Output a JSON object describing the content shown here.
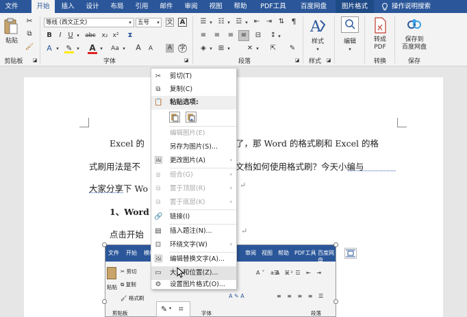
{
  "tabs": [
    "文件",
    "开始",
    "插入",
    "设计",
    "布局",
    "引用",
    "邮件",
    "审阅",
    "视图",
    "帮助",
    "PDF工具",
    "百度网盘",
    "图片格式",
    "操作说明搜索"
  ],
  "ribbon": {
    "paste_label": "粘贴",
    "clipboard_group": "剪贴板",
    "font_name": "等线 (西文正文)",
    "font_size": "五号",
    "font_group": "字体",
    "paragraph_group": "段落",
    "styles_label": "样式",
    "styles_group": "样式",
    "edit_label": "编辑",
    "convert_label": "转成\nPDF",
    "convert_group": "转换",
    "save_label": "保存到\n百度网盘",
    "save_group": "保存",
    "font_grow": "A",
    "font_shrink": "A",
    "wen": "文",
    "change_case": "Aa"
  },
  "document": {
    "lines": [
      "Excel 的",
      "了，那 Word 的格式刷和 Excel 的格",
      "式刷用法是不",
      "文档如何使用格式刷？今天小编与",
      "大家分享下 Wo",
      "1、Word",
      "点击开始"
    ]
  },
  "context_menu": {
    "items": [
      {
        "label": "剪切(T)",
        "icon": "cut-icon",
        "disabled": false
      },
      {
        "label": "复制(C)",
        "icon": "copy-icon",
        "disabled": false
      },
      {
        "label": "粘贴选项:",
        "icon": "paste-icon",
        "header": true
      },
      {
        "label": "编辑图片(E)",
        "disabled": true
      },
      {
        "label": "另存为图片(S)...",
        "disabled": false
      },
      {
        "label": "更改图片(A)",
        "icon": "change-picture-icon",
        "disabled": false,
        "submenu": true
      },
      {
        "label": "组合(G)",
        "icon": "group-icon",
        "disabled": true,
        "submenu": true
      },
      {
        "label": "置于顶层(R)",
        "icon": "bring-front-icon",
        "disabled": true,
        "submenu": true
      },
      {
        "label": "置于底层(K)",
        "icon": "send-back-icon",
        "disabled": true,
        "submenu": true
      },
      {
        "label": "链接(I)",
        "icon": "link-icon",
        "disabled": false
      },
      {
        "label": "插入题注(N)...",
        "icon": "caption-icon",
        "disabled": false
      },
      {
        "label": "环绕文字(W)",
        "icon": "wrap-text-icon",
        "disabled": false,
        "submenu": true
      },
      {
        "label": "编辑替换文字(A)...",
        "icon": "alt-text-icon",
        "disabled": false
      },
      {
        "label": "大小和位置(Z)...",
        "icon": "size-position-icon",
        "disabled": false,
        "highlight": true
      },
      {
        "label": "设置图片格式(O)...",
        "icon": "format-picture-icon",
        "disabled": false
      }
    ]
  },
  "embedded": {
    "tabs": [
      "文件",
      "开始",
      "模板",
      "审阅",
      "视图",
      "帮助",
      "PDF工具",
      "百度网盘"
    ],
    "cut": "剪切",
    "copy": "复制",
    "format_painter": "格式刷",
    "paste": "粘贴",
    "clipboard": "剪贴板",
    "font": "字体",
    "paragraph": "段落"
  }
}
